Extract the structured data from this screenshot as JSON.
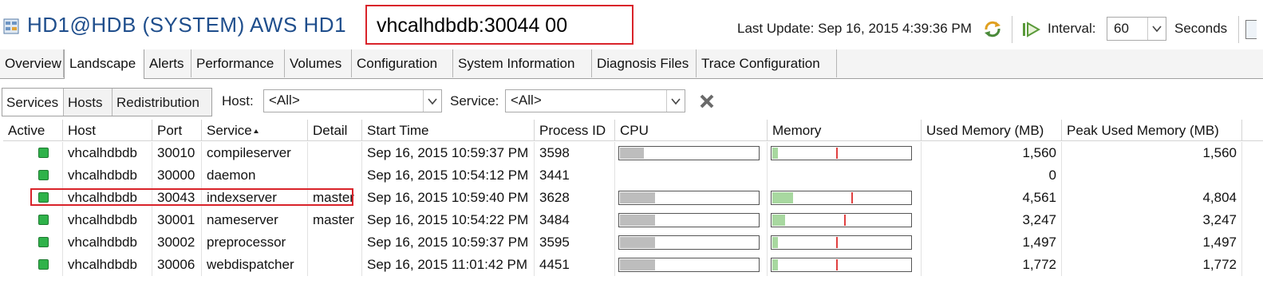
{
  "header": {
    "title": "HD1@HDB (SYSTEM) AWS HD1",
    "connection": "vhcalhdbdb:30044 00",
    "last_update": "Last Update:  Sep 16, 2015 4:39:36 PM",
    "interval_label": "Interval:",
    "interval_value": "60",
    "seconds_label": "Seconds"
  },
  "tabs": [
    {
      "label": "Overview"
    },
    {
      "label": "Landscape"
    },
    {
      "label": "Alerts"
    },
    {
      "label": "Performance"
    },
    {
      "label": "Volumes"
    },
    {
      "label": "Configuration"
    },
    {
      "label": "System Information"
    },
    {
      "label": "Diagnosis Files"
    },
    {
      "label": "Trace Configuration"
    }
  ],
  "active_tab": "Landscape",
  "subtabs": [
    {
      "label": "Services"
    },
    {
      "label": "Hosts"
    },
    {
      "label": "Redistribution"
    }
  ],
  "filters": {
    "host_label": "Host:",
    "host_value": "<All>",
    "service_label": "Service:",
    "service_value": "<All>"
  },
  "table": {
    "columns": [
      "Active",
      "Host",
      "Port",
      "Service",
      "Detail",
      "Start Time",
      "Process ID",
      "CPU",
      "Memory",
      "Used Memory (MB)",
      "Peak Used Memory (MB)"
    ],
    "sorted_column": "Service",
    "rows": [
      {
        "active": "green",
        "host": "vhcalhdbdb",
        "port": "30010",
        "service": "compileserver",
        "detail": "",
        "start_time": "Sep 16, 2015 10:59:37 PM",
        "pid": "3598",
        "cpu": 0.17,
        "mem_used": 0.04,
        "mem_peak": 0.46,
        "used_mb": "1,560",
        "peak_mb": "1,560"
      },
      {
        "active": "green",
        "host": "vhcalhdbdb",
        "port": "30000",
        "service": "daemon",
        "detail": "",
        "start_time": "Sep 16, 2015 10:54:12 PM",
        "pid": "3441",
        "cpu": null,
        "mem_used": null,
        "mem_peak": null,
        "used_mb": "0",
        "peak_mb": ""
      },
      {
        "active": "green",
        "host": "vhcalhdbdb",
        "port": "30043",
        "service": "indexserver",
        "detail": "master",
        "start_time": "Sep 16, 2015 10:59:40 PM",
        "pid": "3628",
        "cpu": 0.25,
        "mem_used": 0.15,
        "mem_peak": 0.57,
        "used_mb": "4,561",
        "peak_mb": "4,804"
      },
      {
        "active": "green",
        "host": "vhcalhdbdb",
        "port": "30001",
        "service": "nameserver",
        "detail": "master",
        "start_time": "Sep 16, 2015 10:54:22 PM",
        "pid": "3484",
        "cpu": 0.25,
        "mem_used": 0.09,
        "mem_peak": 0.52,
        "used_mb": "3,247",
        "peak_mb": "3,247"
      },
      {
        "active": "green",
        "host": "vhcalhdbdb",
        "port": "30002",
        "service": "preprocessor",
        "detail": "",
        "start_time": "Sep 16, 2015 10:59:37 PM",
        "pid": "3595",
        "cpu": 0.25,
        "mem_used": 0.04,
        "mem_peak": 0.46,
        "used_mb": "1,497",
        "peak_mb": "1,497"
      },
      {
        "active": "green",
        "host": "vhcalhdbdb",
        "port": "30006",
        "service": "webdispatcher",
        "detail": "",
        "start_time": "Sep 16, 2015 11:01:42 PM",
        "pid": "4451",
        "cpu": 0.25,
        "mem_used": 0.04,
        "mem_peak": 0.46,
        "used_mb": "1,772",
        "peak_mb": "1,772"
      }
    ]
  },
  "colors": {
    "title": "#1f4e8c",
    "highlight": "#d9232a",
    "active_led": "#2fb24a",
    "mem_fill": "#a8d8a0",
    "mem_peak_mark": "#e04040"
  },
  "icons": {
    "system": "database-icon",
    "refresh": "refresh-icon",
    "auto_refresh": "play-icon",
    "clear_filter": "clear-filter-icon"
  }
}
